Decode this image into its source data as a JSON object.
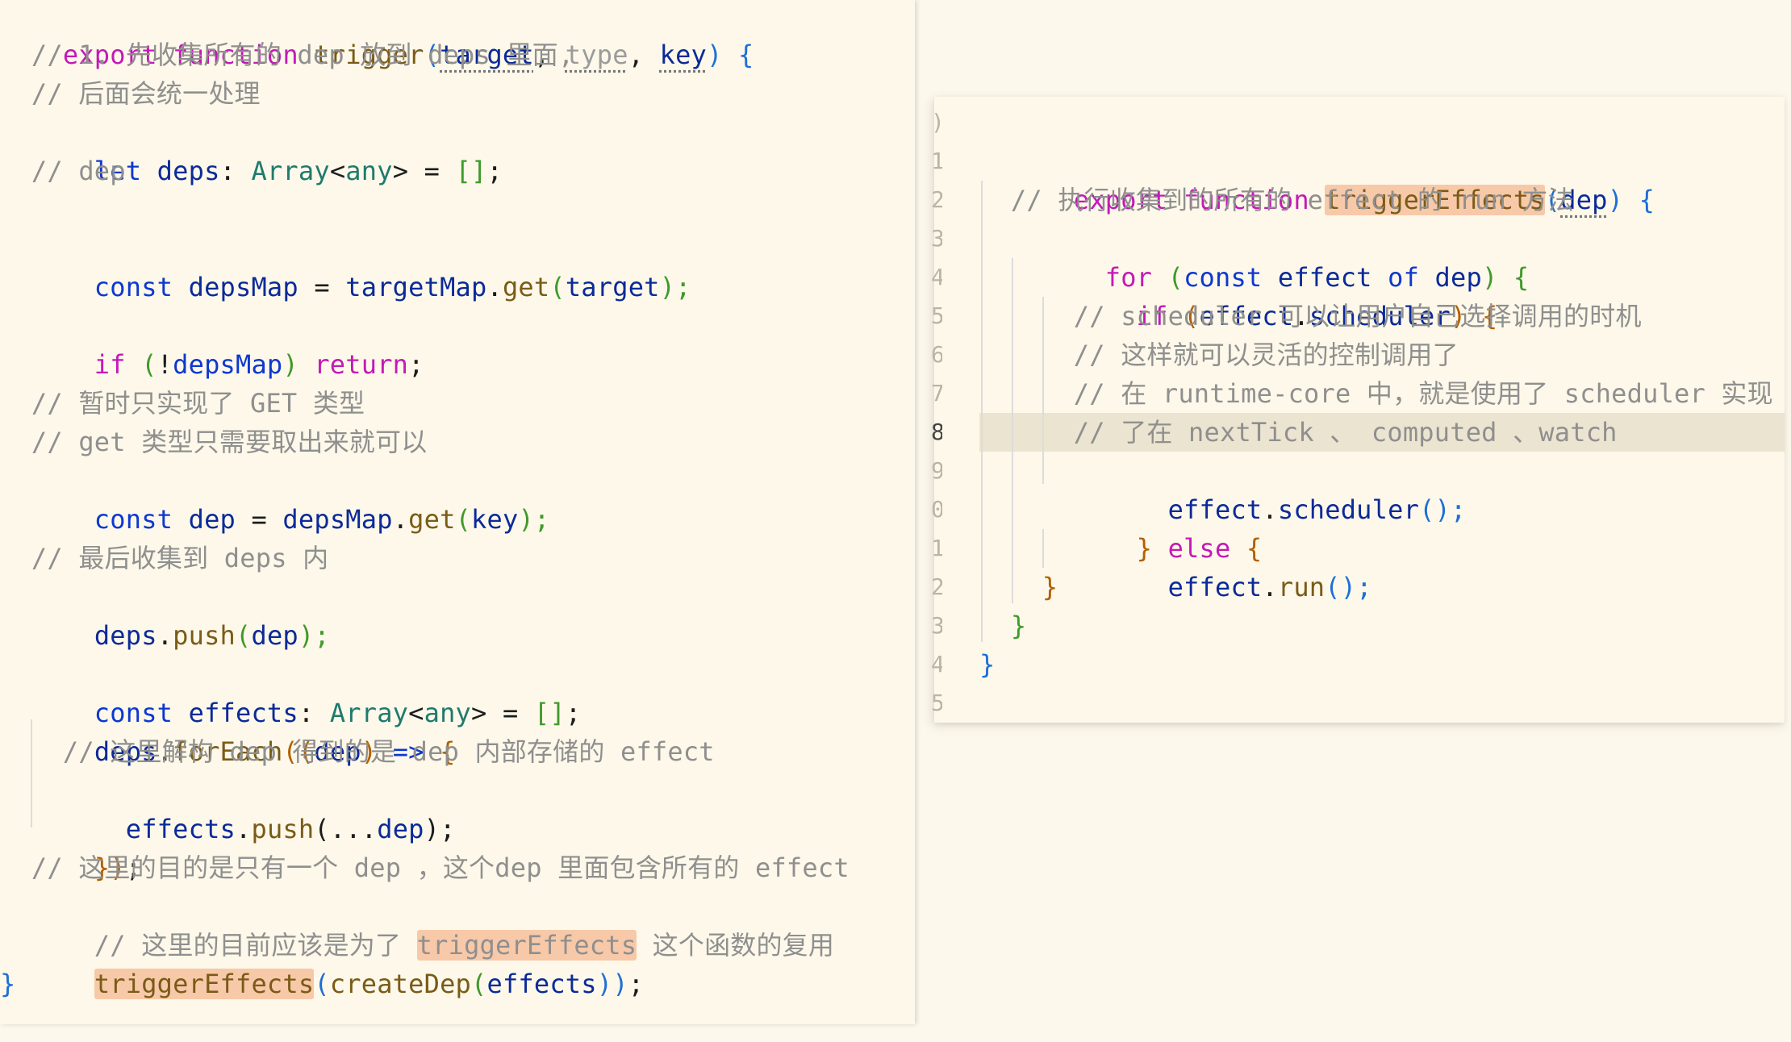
{
  "left_editor": {
    "lines": [
      [
        "export function ",
        "trigger",
        "(",
        "target",
        ", ",
        "type",
        ", ",
        "key",
        ") {"
      ],
      [
        "  // 1. 先收集所有的 dep 放到 deps 里面,"
      ],
      [
        "  // 后面会统一处理"
      ],
      [
        "  let ",
        "deps",
        ": ",
        "Array",
        "<",
        "any",
        "> = ",
        "[]",
        ";"
      ],
      [
        "  // dep"
      ],
      [
        ""
      ],
      [
        "  const ",
        "depsMap",
        " = ",
        "targetMap",
        ".",
        "get",
        "(",
        "target",
        ");"
      ],
      [
        ""
      ],
      [
        "  if ",
        "(",
        "!",
        "depsMap",
        ") ",
        "return",
        ";"
      ],
      [
        ""
      ],
      [
        "  // 暂时只实现了 GET 类型"
      ],
      [
        "  // get 类型只需要取出来就可以"
      ],
      [
        "  const ",
        "dep",
        " = ",
        "depsMap",
        ".",
        "get",
        "(",
        "key",
        ");"
      ],
      [
        ""
      ],
      [
        "  // 最后收集到 deps 内"
      ],
      [
        "  ",
        "deps",
        ".",
        "push",
        "(",
        "dep",
        ");"
      ],
      [
        ""
      ],
      [
        "  const ",
        "effects",
        ": ",
        "Array",
        "<",
        "any",
        "> = ",
        "[]",
        ";"
      ],
      [
        "  ",
        "deps",
        ".",
        "forEach",
        "((",
        "dep",
        ") ",
        "=>",
        " {"
      ],
      [
        "    // 这里解构 dep 得到的是 dep 内部存储的 effect"
      ],
      [
        "    ",
        "effects",
        ".",
        "push",
        "(...",
        "dep",
        ");"
      ],
      [
        "  ",
        "})",
        ";"
      ],
      [
        "  // 这里的目的是只有一个 dep ，这个dep 里面包含所有的 effect"
      ],
      [
        "  // 这里的目前应该是为了 ",
        "triggerEffects",
        " 这个函数的复用"
      ],
      [
        "  ",
        "triggerEffects",
        "(",
        "createDep",
        "(",
        "effects",
        "))",
        ";"
      ],
      [
        "}"
      ]
    ]
  },
  "right_editor": {
    "gutter": [
      ")",
      "1",
      "2",
      "3",
      "4",
      "5",
      "6",
      "7",
      "8",
      "9",
      "0",
      "1",
      "2",
      "3",
      "4",
      "5"
    ],
    "lines": [
      [
        ""
      ],
      [
        "export function ",
        "triggerEffects",
        "(",
        "dep",
        ") {"
      ],
      [
        "  // 执行收集到的所有的 effect 的 run 方法"
      ],
      [
        "  for ",
        "(",
        "const ",
        "effect",
        " of ",
        "dep",
        ") {"
      ],
      [
        "    if ",
        "(",
        "effect",
        ".",
        "scheduler",
        ") {"
      ],
      [
        "      // scheduler 可以让用户自己选择调用的时机"
      ],
      [
        "      // 这样就可以灵活的控制调用了"
      ],
      [
        "      // 在 runtime-core 中，就是使用了 scheduler 实现"
      ],
      [
        "      // 了在 nextTick 、 computed 、watch"
      ],
      [
        "      ",
        "effect",
        ".",
        "scheduler",
        "();"
      ],
      [
        "    } ",
        "else",
        " {"
      ],
      [
        "      ",
        "effect",
        ".",
        "run",
        "();"
      ],
      [
        "    }"
      ],
      [
        "  }"
      ],
      [
        "}"
      ],
      [
        ""
      ]
    ]
  }
}
